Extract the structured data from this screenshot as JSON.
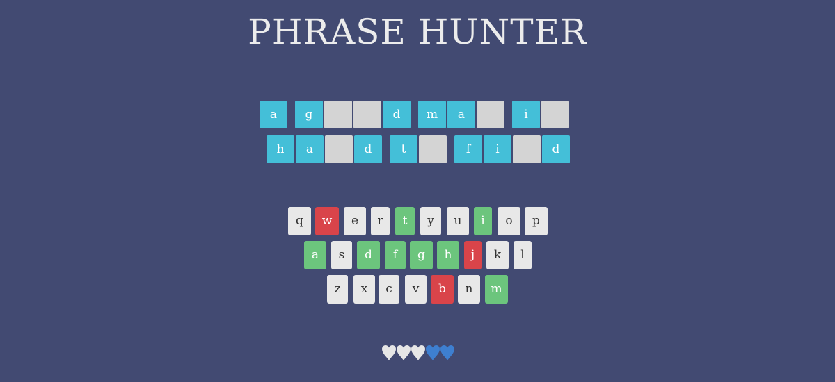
{
  "title": "PHRASE HUNTER",
  "phrase": {
    "lines": [
      [
        {
          "char": "a",
          "revealed": true
        },
        {
          "char": "g",
          "revealed": true
        },
        {
          "char": "",
          "revealed": false
        },
        {
          "char": "",
          "revealed": false
        },
        {
          "char": "d",
          "revealed": true
        },
        {
          "char": "m",
          "revealed": true
        },
        {
          "char": "a",
          "revealed": true
        },
        {
          "char": "",
          "revealed": false
        },
        {
          "char": "i",
          "revealed": true
        },
        {
          "char": "",
          "revealed": false
        }
      ],
      [
        {
          "char": "h",
          "revealed": true
        },
        {
          "char": "a",
          "revealed": true
        },
        {
          "char": "",
          "revealed": false
        },
        {
          "char": "d",
          "revealed": true
        },
        {
          "char": "t",
          "revealed": true
        },
        {
          "char": "",
          "revealed": false
        },
        {
          "char": "f",
          "revealed": true
        },
        {
          "char": "i",
          "revealed": true
        },
        {
          "char": "",
          "revealed": false
        },
        {
          "char": "d",
          "revealed": true
        }
      ]
    ]
  },
  "keyboard": {
    "rows": [
      [
        {
          "letter": "q",
          "state": "unused"
        },
        {
          "letter": "w",
          "state": "wrong"
        },
        {
          "letter": "e",
          "state": "unused"
        },
        {
          "letter": "r",
          "state": "unused"
        },
        {
          "letter": "t",
          "state": "chosen"
        },
        {
          "letter": "y",
          "state": "unused"
        },
        {
          "letter": "u",
          "state": "unused"
        },
        {
          "letter": "i",
          "state": "chosen"
        },
        {
          "letter": "o",
          "state": "unused"
        },
        {
          "letter": "p",
          "state": "unused"
        }
      ],
      [
        {
          "letter": "a",
          "state": "chosen"
        },
        {
          "letter": "s",
          "state": "unused"
        },
        {
          "letter": "d",
          "state": "chosen"
        },
        {
          "letter": "f",
          "state": "chosen"
        },
        {
          "letter": "g",
          "state": "chosen"
        },
        {
          "letter": "h",
          "state": "chosen"
        },
        {
          "letter": "j",
          "state": "wrong"
        },
        {
          "letter": "k",
          "state": "unused"
        },
        {
          "letter": "l",
          "state": "unused"
        }
      ],
      [
        {
          "letter": "z",
          "state": "unused"
        },
        {
          "letter": "x",
          "state": "unused"
        },
        {
          "letter": "c",
          "state": "unused"
        },
        {
          "letter": "v",
          "state": "unused"
        },
        {
          "letter": "b",
          "state": "wrong"
        },
        {
          "letter": "n",
          "state": "unused"
        },
        {
          "letter": "m",
          "state": "chosen"
        }
      ]
    ]
  },
  "lives": {
    "total": 5,
    "remaining": 2,
    "lost_color": "#e6e6e6",
    "live_color": "#3e7fd0"
  },
  "colors": {
    "background": "#424a72",
    "revealed_tile": "#44bfd8",
    "hidden_tile": "#d4d4d4",
    "key_unused": "#e8e8e8",
    "key_chosen": "#6cc57d",
    "key_wrong": "#d9444a"
  }
}
